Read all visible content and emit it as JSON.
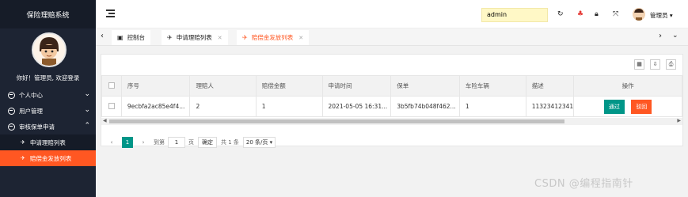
{
  "app": {
    "title": "保险理赔系统",
    "welcome": "你好！管理员, 欢迎登录"
  },
  "sidebar": {
    "items": [
      {
        "label": "个人中心",
        "chevron": "⌄"
      },
      {
        "label": "用户管理",
        "chevron": "⌄"
      },
      {
        "label": "审核保单申请",
        "chevron": "⌃"
      }
    ],
    "subitems": [
      {
        "label": "申请理赔列表",
        "icon": "✈"
      },
      {
        "label": "赔偿金发放列表",
        "icon": "✈"
      }
    ]
  },
  "topbar": {
    "menu_icon": "≡",
    "search_value": "admin",
    "icons": [
      "refresh-icon",
      "bell-icon",
      "lock-icon",
      "fullscreen-icon"
    ],
    "user_label": "管理员 ▾"
  },
  "tabs": [
    {
      "label": "控制台",
      "icon": "▣",
      "close": ""
    },
    {
      "label": "申请理赔列表",
      "icon": "✈",
      "close": "✕"
    },
    {
      "label": "赔偿金发放列表",
      "icon": "✈",
      "close": "✕"
    }
  ],
  "table": {
    "headers": [
      "序号",
      "理赔人",
      "赔偿金额",
      "申请时间",
      "保单",
      "车险车辆",
      "描述",
      "操作"
    ],
    "rows": [
      {
        "id": "9ecbfa2ac85e4f4...",
        "person": "2",
        "amount": "1",
        "time": "2021-05-05 16:31...",
        "policy": "3b5fb74b048f462...",
        "vehicle": "1",
        "desc": "11323412341",
        "pass": "通过",
        "reject": "驳回"
      }
    ]
  },
  "pager": {
    "prev": "‹",
    "current": "1",
    "next": "›",
    "goto_label": "到第",
    "goto_value": "1",
    "page_unit": "页",
    "confirm": "确定",
    "total": "共 1 条",
    "per_page": "20 条/页 ▾"
  },
  "watermark": "CSDN @编程指南针",
  "colors": {
    "sidebar": "#1d2433",
    "accent": "#ff5722",
    "pass": "#009688"
  }
}
